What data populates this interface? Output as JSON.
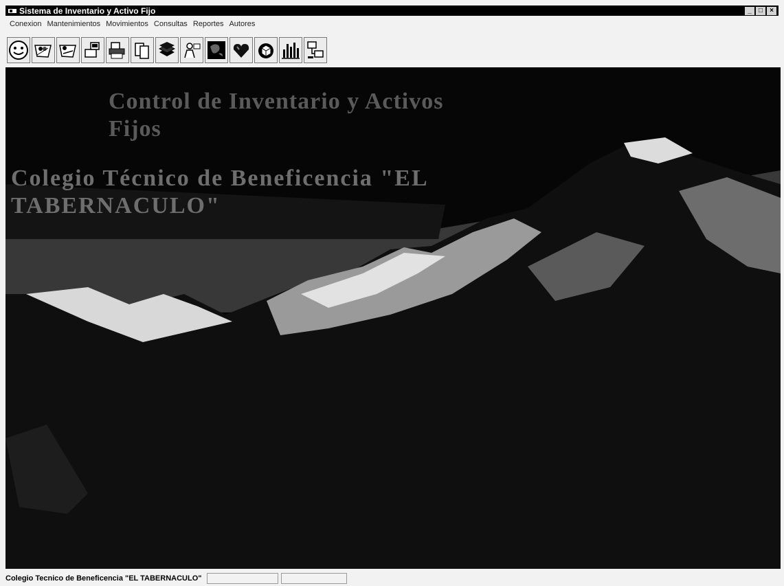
{
  "window": {
    "title": "Sistema de Inventario y Activo Fijo"
  },
  "window_controls": [
    "_",
    "□",
    "×"
  ],
  "menu": {
    "items": [
      "Conexion",
      "Mantenimientos",
      "Movimientos",
      "Consultas",
      "Reportes",
      "Autores"
    ]
  },
  "toolbar": {
    "buttons": [
      "smiley-icon",
      "connection-icon",
      "disconnect-icon",
      "computer-user-icon",
      "printer-icon",
      "documents-icon",
      "books-icon",
      "user-edit-icon",
      "globe-icon",
      "heart-icon",
      "cube-icon",
      "chart-icon",
      "network-icon"
    ]
  },
  "banner": {
    "title": "Control de Inventario y Activos Fijos",
    "school": "Colegio Técnico de Beneficencia \"EL TABERNACULO\""
  },
  "status": {
    "text": "Colegio Tecnico de Beneficencia \"EL TABERNACULO\""
  },
  "colors": {
    "titlebar": "#000000",
    "menubar_bg": "#f2f2f2",
    "main_bg": "#050505",
    "sky": "#383838"
  }
}
